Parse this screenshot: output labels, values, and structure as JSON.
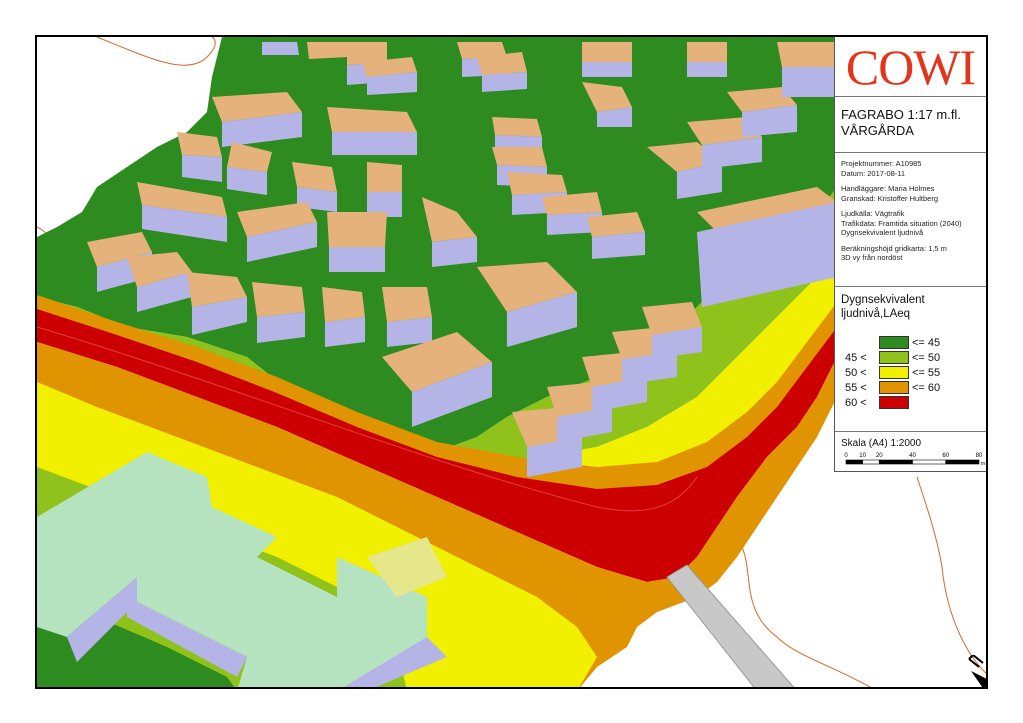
{
  "map": {
    "logo": "COWI",
    "title_line1": "FAGRABO 1:17 m.fl.",
    "title_line2": "VÅRGÅRDA",
    "info": {
      "project": "Projektnummer: A10985",
      "date": "Datum: 2017-08-11",
      "handler": "Handläggare: Maria Holmes",
      "reviewer": "Granskad: Kristoffer Hultberg",
      "source": "Ljudkälla: Vägtrafik",
      "traffic": "Trafikdata: Framtida situation (2040)",
      "measure": "Dygnsekvivalent ljudnivå",
      "height": "Beräkningshöjd gridkarta: 1,5 m",
      "view": "3D vy från nordöst"
    },
    "legend": {
      "title1": "Dygnsekvivalent",
      "title2": "ljudnivå,LAeq",
      "classes": [
        {
          "lower": "",
          "upper": "<= 45",
          "color": "#2e8b1f"
        },
        {
          "lower": "45 <",
          "upper": "<= 50",
          "color": "#8fc21a"
        },
        {
          "lower": "50 <",
          "upper": "<= 55",
          "color": "#f0f000"
        },
        {
          "lower": "55 <",
          "upper": "<= 60",
          "color": "#e09400"
        },
        {
          "lower": "60 <",
          "upper": "",
          "color": "#cc0000"
        }
      ]
    },
    "scale": {
      "label": "Skala (A4) 1:2000",
      "ticks": [
        "0",
        "10",
        "20",
        "40",
        "60",
        "80"
      ],
      "unit": "m"
    },
    "north_icon": "north-arrow-icon"
  }
}
